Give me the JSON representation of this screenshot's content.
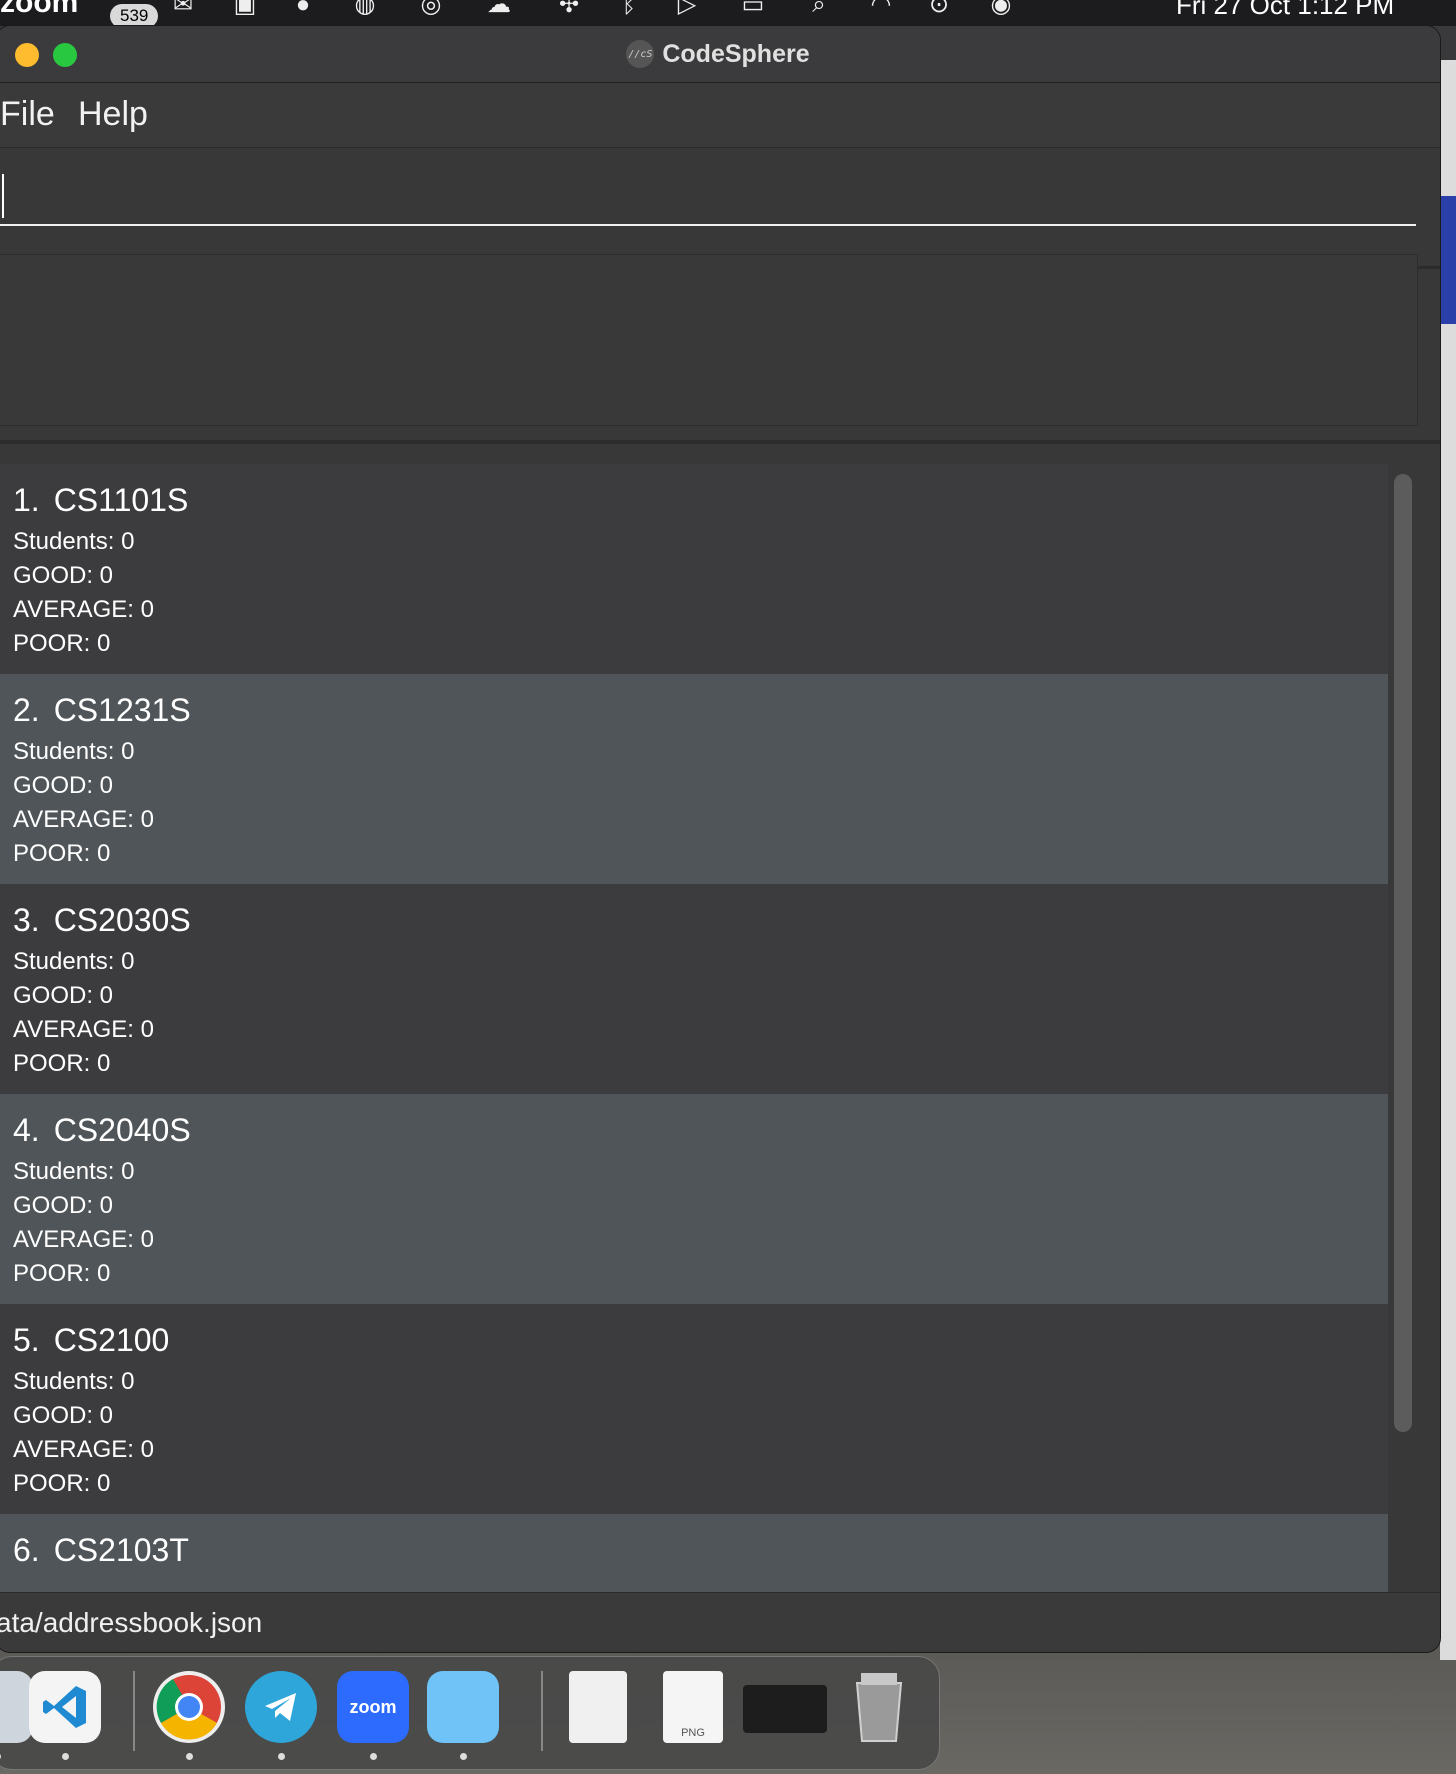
{
  "menubar": {
    "app_name": "zoom",
    "badge": "539",
    "clock": "Fri 27 Oct  1:12 PM"
  },
  "window": {
    "title": "CodeSphere",
    "icon_text": "//cS"
  },
  "menu": {
    "file": "File",
    "help": "Help"
  },
  "command": {
    "value": "",
    "placeholder": ""
  },
  "courses": [
    {
      "index": "1.",
      "name": "CS1101S",
      "students": "Students: 0",
      "good": "GOOD: 0",
      "average": "AVERAGE: 0",
      "poor": "POOR: 0"
    },
    {
      "index": "2.",
      "name": "CS1231S",
      "students": "Students: 0",
      "good": "GOOD: 0",
      "average": "AVERAGE: 0",
      "poor": "POOR: 0"
    },
    {
      "index": "3.",
      "name": "CS2030S",
      "students": "Students: 0",
      "good": "GOOD: 0",
      "average": "AVERAGE: 0",
      "poor": "POOR: 0"
    },
    {
      "index": "4.",
      "name": "CS2040S",
      "students": "Students: 0",
      "good": "GOOD: 0",
      "average": "AVERAGE: 0",
      "poor": "POOR: 0"
    },
    {
      "index": "5.",
      "name": "CS2100",
      "students": "Students: 0",
      "good": "GOOD: 0",
      "average": "AVERAGE: 0",
      "poor": "POOR: 0"
    },
    {
      "index": "6.",
      "name": "CS2103T",
      "students": "",
      "good": "",
      "average": "",
      "poor": ""
    }
  ],
  "status": {
    "path": "ata/addressbook.json"
  },
  "dock": {
    "zoom_label": "zoom",
    "png_label": "PNG"
  },
  "colors": {
    "traffic_yellow": "#febc2e",
    "traffic_green": "#28c840",
    "card_dark": "#3c3c3e",
    "card_light": "#4f5558"
  }
}
